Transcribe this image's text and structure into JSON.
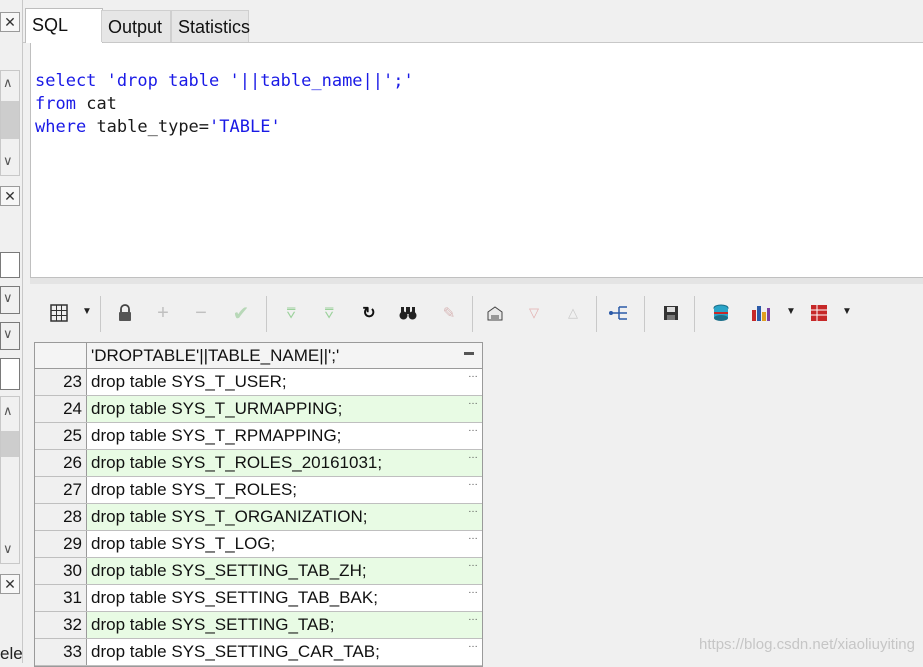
{
  "tabs": [
    {
      "label": "SQL",
      "active": true
    },
    {
      "label": "Output",
      "active": false
    },
    {
      "label": "Statistics",
      "active": false
    }
  ],
  "editor": {
    "line1": {
      "kw": "select",
      "str": "'drop table '||table_name||';'"
    },
    "line2": {
      "kw": "from",
      "id": "cat"
    },
    "line3": {
      "kw": "where",
      "id": "table_type=",
      "str": "'TABLE'"
    }
  },
  "toolbar_icons": [
    "grid-view-icon",
    "lock-icon",
    "add-record-icon",
    "delete-record-icon",
    "post-edit-icon",
    "fetch-next-icon",
    "fetch-last-icon",
    "refresh-icon",
    "find-icon",
    "clear-icon",
    "export-icon",
    "filter-down-icon",
    "filter-up-icon",
    "tree-icon",
    "save-icon",
    "database-icon",
    "chart-icon",
    "table-icon"
  ],
  "grid": {
    "column_header": "'DROPTABLE'||TABLE_NAME||';'",
    "rows": [
      {
        "num": "23",
        "value": "drop table SYS_T_USER;"
      },
      {
        "num": "24",
        "value": "drop table SYS_T_URMAPPING;"
      },
      {
        "num": "25",
        "value": "drop table SYS_T_RPMAPPING;"
      },
      {
        "num": "26",
        "value": "drop table SYS_T_ROLES_20161031;"
      },
      {
        "num": "27",
        "value": "drop table SYS_T_ROLES;"
      },
      {
        "num": "28",
        "value": "drop table SYS_T_ORGANIZATION;"
      },
      {
        "num": "29",
        "value": "drop table SYS_T_LOG;"
      },
      {
        "num": "30",
        "value": "drop table SYS_SETTING_TAB_ZH;"
      },
      {
        "num": "31",
        "value": "drop table SYS_SETTING_TAB_BAK;"
      },
      {
        "num": "32",
        "value": "drop table SYS_SETTING_TAB;"
      },
      {
        "num": "33",
        "value": "drop table SYS_SETTING_CAR_TAB;"
      }
    ]
  },
  "left_strip_text": "ele",
  "watermark": "https://blog.csdn.net/xiaoliuyiting",
  "colors": {
    "keyword": "#1a1ae6",
    "alt_row": "#e8fbe4"
  }
}
